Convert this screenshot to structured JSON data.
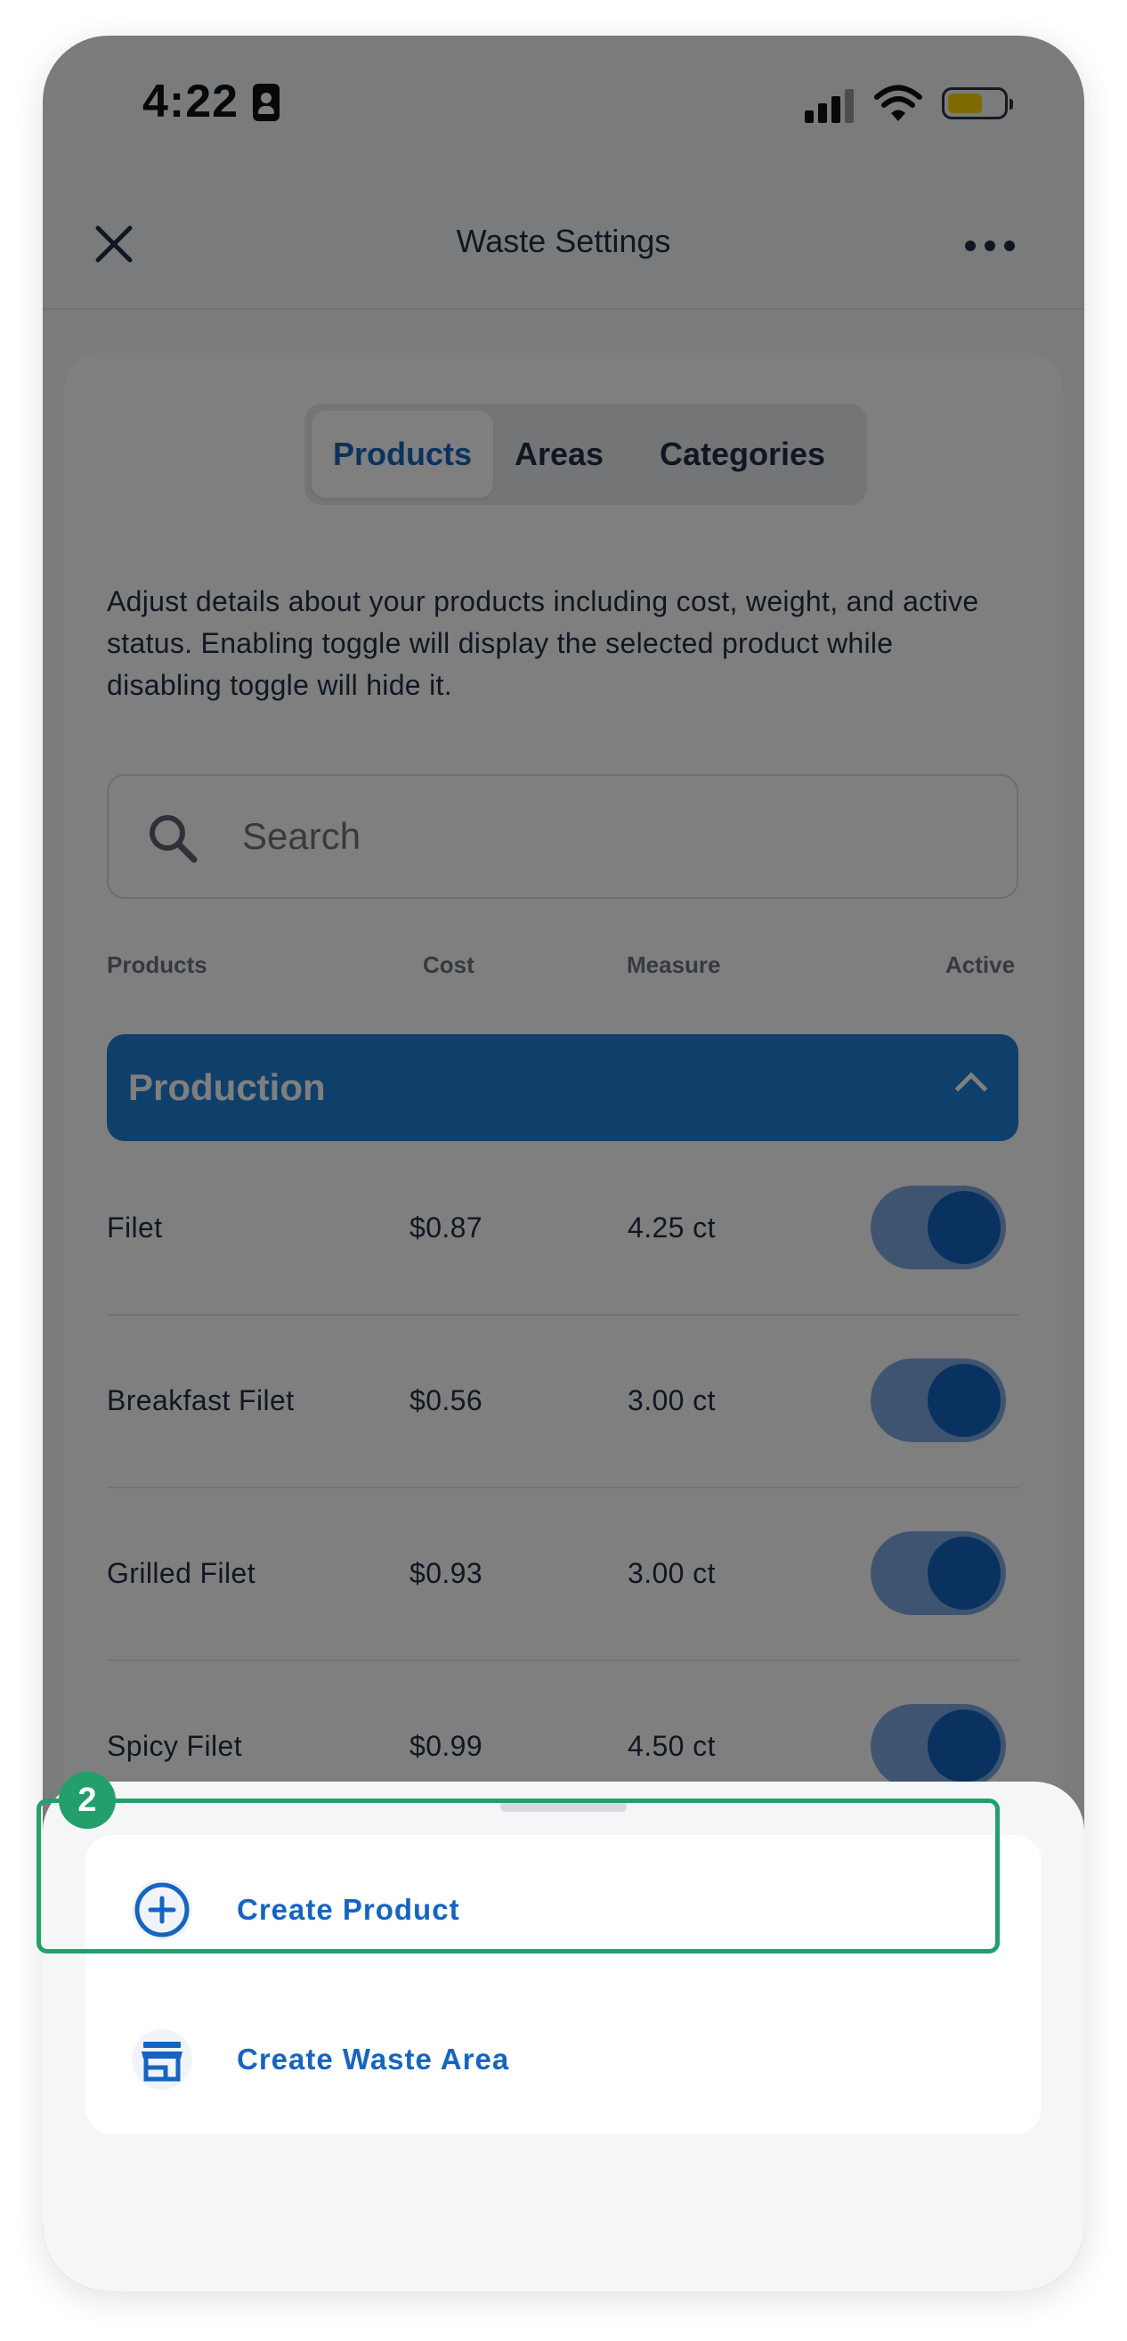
{
  "status_bar": {
    "time": "4:22"
  },
  "header": {
    "title": "Waste Settings"
  },
  "tabs": [
    {
      "label": "Products",
      "active": true
    },
    {
      "label": "Areas",
      "active": false
    },
    {
      "label": "Categories",
      "active": false
    }
  ],
  "description": "Adjust details about your products including cost, weight, and active status. Enabling toggle will display the selected product while disabling toggle will hide it.",
  "search": {
    "placeholder": "Search",
    "value": ""
  },
  "columns": {
    "products": "Products",
    "cost": "Cost",
    "measure": "Measure",
    "active": "Active"
  },
  "group": {
    "title": "Production",
    "expanded": true
  },
  "rows": [
    {
      "name": "Filet",
      "cost": "$0.87",
      "measure": "4.25 ct",
      "active": true
    },
    {
      "name": "Breakfast Filet",
      "cost": "$0.56",
      "measure": "3.00 ct",
      "active": true
    },
    {
      "name": "Grilled Filet",
      "cost": "$0.93",
      "measure": "3.00 ct",
      "active": true
    },
    {
      "name": "Spicy Filet",
      "cost": "$0.99",
      "measure": "4.50 ct",
      "active": true
    }
  ],
  "sheet": {
    "items": [
      {
        "label": "Create Product",
        "icon": "plus-circle-icon"
      },
      {
        "label": "Create Waste Area",
        "icon": "storefront-icon"
      }
    ]
  },
  "annotation": {
    "step": "2"
  },
  "colors": {
    "accent": "#1565c0",
    "group_bg": "#1e7fd6",
    "highlight": "#22a06b",
    "battery": "#ffd400"
  }
}
